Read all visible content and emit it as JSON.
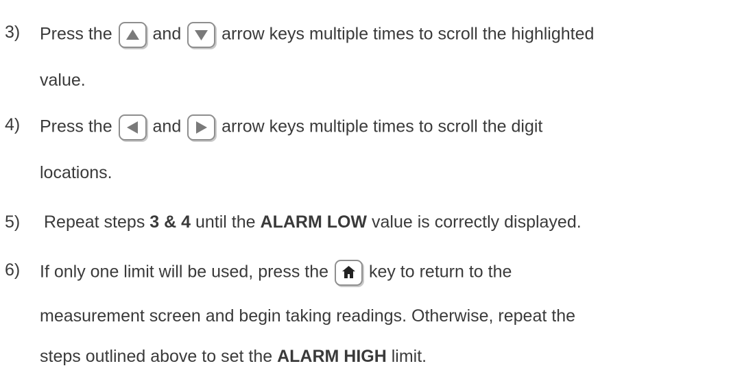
{
  "steps": [
    {
      "number": "3)",
      "pre": "Press the",
      "mid": "and",
      "post": "arrow keys multiple times to scroll the highlighted",
      "cont": "value.",
      "key1_icon": "up-arrow-key-icon",
      "key2_icon": "down-arrow-key-icon"
    },
    {
      "number": "4)",
      "pre": "Press the",
      "mid": "and",
      "post": "arrow keys multiple times to scroll the digit",
      "cont": "locations.",
      "key1_icon": "left-arrow-key-icon",
      "key2_icon": "right-arrow-key-icon"
    },
    {
      "number": "5)",
      "pre": "Repeat steps",
      "bold1": "3 & 4",
      "mid": "until the",
      "bold2": "ALARM LOW",
      "post": "value is correctly displayed."
    },
    {
      "number": "6)",
      "pre": "If only one limit will be used, press the",
      "post": "key to return to the",
      "cont1": "measurement screen and begin taking readings.  Otherwise, repeat the",
      "cont2_pre": "steps outlined above to set the",
      "cont2_bold": "ALARM HIGH",
      "cont2_post": "limit.",
      "key_icon": "home-key-icon"
    }
  ],
  "colors": {
    "text": "#3a3a3a",
    "key_border": "#8e8e8e",
    "key_glyph": "#7a7a7a"
  }
}
